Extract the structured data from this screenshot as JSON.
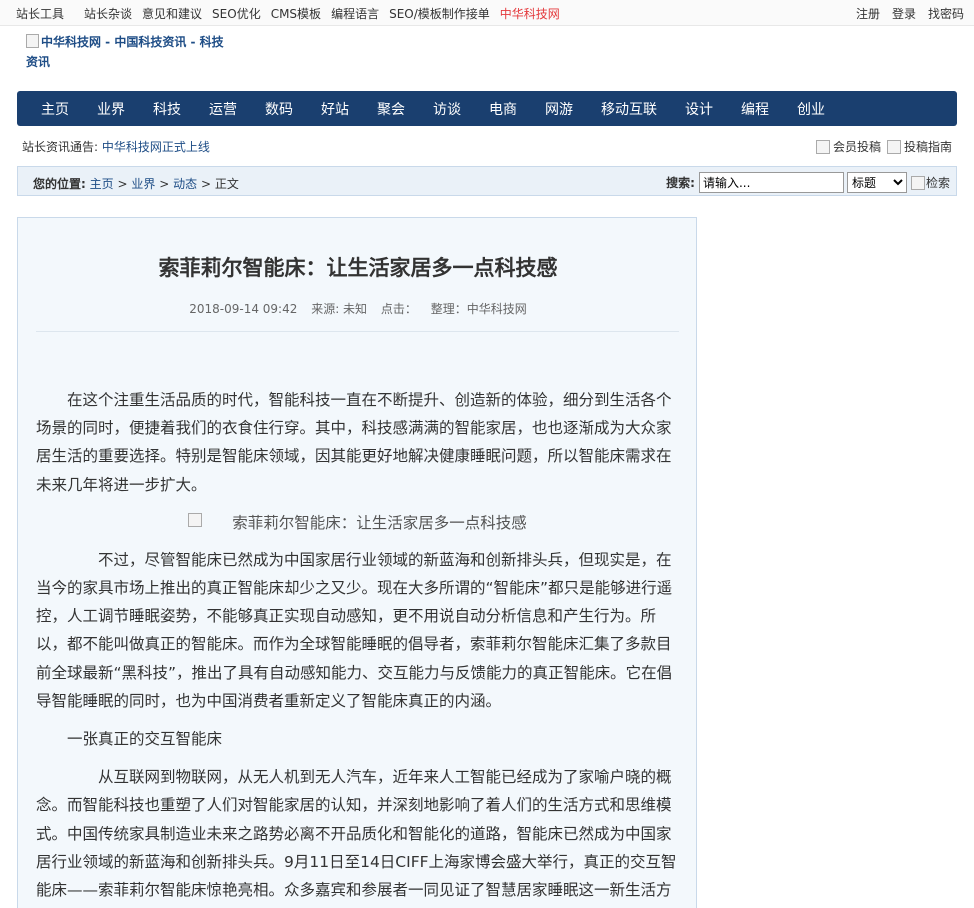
{
  "topbar": {
    "left": [
      "站长工具",
      "站长杂谈",
      "意见和建议",
      "SEO优化",
      "CMS模板",
      "编程语言",
      "SEO/模板制作接单"
    ],
    "highlight": "中华科技网",
    "right": [
      "注册",
      "登录",
      "找密码"
    ]
  },
  "logo": {
    "alt": "中华科技网 - 中国科技资讯 - 科技资讯"
  },
  "nav": [
    "主页",
    "业界",
    "科技",
    "运营",
    "数码",
    "好站",
    "聚会",
    "访谈",
    "电商",
    "网游",
    "移动互联",
    "设计",
    "编程",
    "创业"
  ],
  "notice": {
    "label": "站长资讯通告:",
    "link": "中华科技网正式上线"
  },
  "tools": {
    "submit": "会员投稿",
    "guide": "投稿指南"
  },
  "breadcrumb": {
    "label": "您的位置:",
    "home": "主页",
    "sep": ">",
    "cat": "业界",
    "sub": "动态",
    "current": "正文"
  },
  "search": {
    "label": "搜索:",
    "placeholder": "请输入...",
    "option": "标题",
    "button": "检索"
  },
  "article": {
    "title": "索菲莉尔智能床：让生活家居多一点科技感",
    "date": "2018-09-14 09:42",
    "source": "来源: 未知",
    "clicks": "点击：",
    "editor": "整理：中华科技网",
    "p1": "在这个注重生活品质的时代，智能科技一直在不断提升、创造新的体验，细分到生活各个场景的同时，便捷着我们的衣食住行穿。其中，科技感满满的智能家居，也也逐渐成为大众家居生活的重要选择。特别是智能床领域，因其能更好地解决健康睡眠问题，所以智能床需求在未来几年将进一步扩大。",
    "image_alt": "索菲莉尔智能床：让生活家居多一点科技感",
    "p2": "不过，尽管智能床已然成为中国家居行业领域的新蓝海和创新排头兵，但现实是，在当今的家具市场上推出的真正智能床却少之又少。现在大多所谓的“智能床”都只是能够进行遥控，人工调节睡眠姿势，不能够真正实现自动感知，更不用说自动分析信息和产生行为。所以，都不能叫做真正的智能床。而作为全球智能睡眠的倡导者，索菲莉尔智能床汇集了多款目前全球最新“黑科技”，推出了具有自动感知能力、交互能力与反馈能力的真正智能床。它在倡导智能睡眠的同时，也为中国消费者重新定义了智能床真正的内涵。",
    "subhead": "一张真正的交互智能床",
    "p3": "从互联网到物联网，从无人机到无人汽车，近年来人工智能已经成为了家喻户晓的概念。而智能科技也重塑了人们对智能家居的认知，并深刻地影响了着人们的生活方式和思维模式。中国传统家具制造业未来之路势必离不开品质化和智能化的道路，智能床已然成为中国家居行业领域的新蓝海和创新排头兵。9月11日至14日CIFF上海家博会盛大举行，真正的交互智能床——索菲莉尔智能床惊艳亮相。众多嘉宾和参展者一同见证了智慧居家睡眠这一新生活方式的发布落地。"
  }
}
